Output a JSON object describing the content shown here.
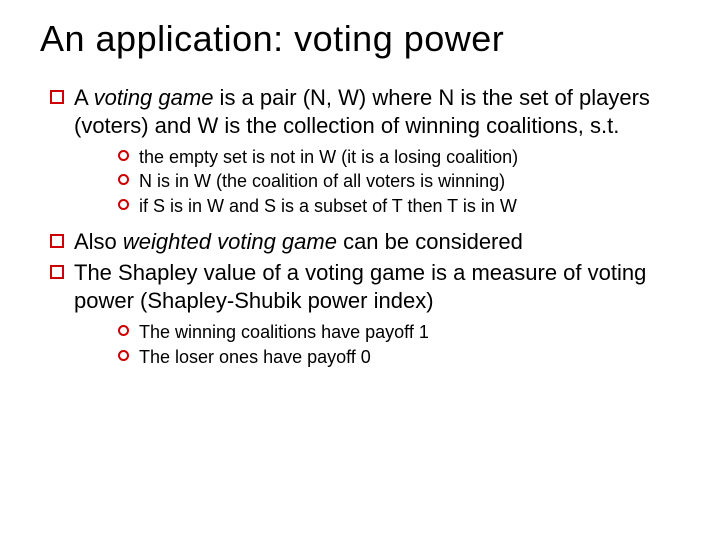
{
  "title": "An application: voting power",
  "b1": {
    "a_prefix": "A ",
    "a_em": "voting game",
    "a_suffix": " is a pair (N, W) where N is the set of players (voters) and W is the collection of winning coalitions, s.t.",
    "sub_a": [
      "the empty set is not in W (it is a losing coalition)",
      "N is in W (the coalition of all voters is winning)",
      "if S is in W and S is a subset of T then T is in W"
    ],
    "b_prefix": "Also ",
    "b_em": "weighted voting game",
    "b_suffix": " can be considered",
    "c": "The Shapley value of a voting game is a measure of voting power (Shapley-Shubik power index)",
    "sub_c": [
      "The winning coalitions have payoff 1",
      "The loser ones have payoff 0"
    ]
  }
}
